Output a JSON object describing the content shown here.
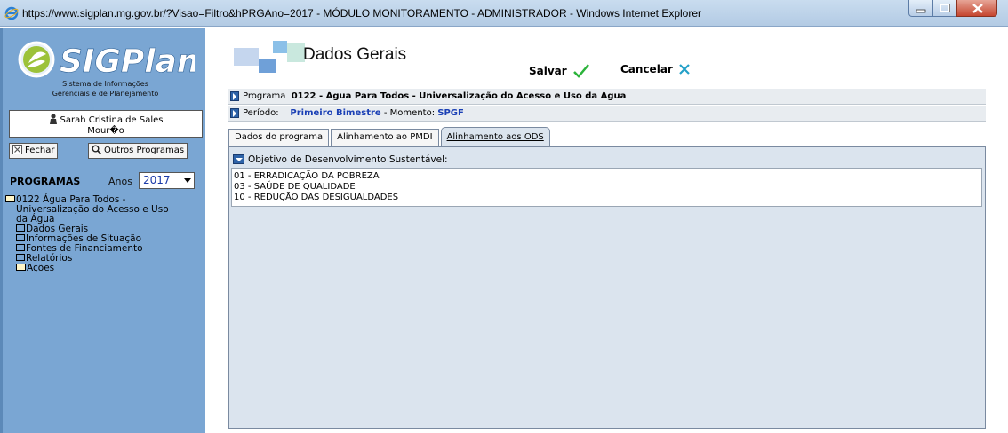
{
  "window": {
    "title": "https://www.sigplan.mg.gov.br/?Visao=Filtro&hPRGAno=2017 - MÓDULO MONITORAMENTO - ADMINISTRADOR - Windows Internet Explorer"
  },
  "sidebar": {
    "logo_text": "SIGPlan",
    "logo_subtitle_1": "Sistema de Informações",
    "logo_subtitle_2": "Gerenciais e de Planejamento",
    "user_line_1": "Sarah Cristina de Sales",
    "user_line_2": "Mour�o",
    "close_label": "Fechar",
    "other_programs_label": "Outros Programas",
    "programs_heading": "PROGRAMAS",
    "years_label": "Anos",
    "year_value": "2017",
    "tree": {
      "root_line_1": "0122 Água Para Todos -",
      "root_line_2": "Universalização do Acesso e Uso",
      "root_line_3": "da Água",
      "items": [
        "Dados Gerais",
        "Informações de Situação",
        "Fontes de Financiamento",
        "Relatórios",
        "Ações"
      ]
    }
  },
  "main": {
    "page_title": "Dados Gerais",
    "save_label": "Salvar",
    "cancel_label": "Cancelar",
    "program_label": "Programa",
    "program_value": "0122 - Água Para Todos - Universalização do Acesso e Uso da Água",
    "period_label": "Período:",
    "period_value": "Primeiro Bimestre",
    "moment_label": "- Momento:",
    "moment_value": "SPGF",
    "tabs": [
      "Dados do programa",
      "Alinhamento ao PMDI",
      "Alinhamento aos ODS"
    ],
    "ods_heading": "Objetivo de Desenvolvimento Sustentável:",
    "ods_items": [
      "01 - ERRADICAÇÃO DA POBREZA",
      "03 - SAÚDE DE QUALIDADE",
      "10 - REDUÇÃO DAS DESIGUALDADES"
    ]
  },
  "colors": {
    "sidebar_bg": "#7aa6d3",
    "panel_bg": "#dbe4ee",
    "accent_blue": "#1a3fb5",
    "check_green": "#2bb33a",
    "cancel_x": "#23a0c8"
  }
}
